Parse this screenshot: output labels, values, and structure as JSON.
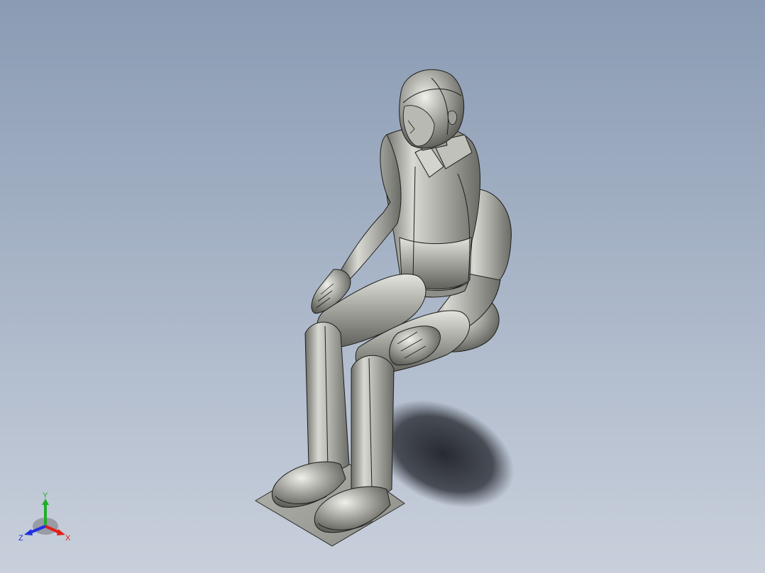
{
  "viewport": {
    "colors": {
      "background_top": "#8a9bb3",
      "background_bottom": "#c9d0dc",
      "model_metal": "#a9aaa4",
      "model_highlight": "#e6e6e0",
      "model_shadow": "#5d5e58",
      "floor_shadow": "#2b2e35",
      "base_plate": "#9c9d97"
    },
    "model": {
      "description_icon": "seated-human-model-icon"
    }
  },
  "triad": {
    "x_label": "X",
    "y_label": "Y",
    "z_label": "Z",
    "x_color": "#e0201c",
    "y_color": "#1fae2a",
    "z_color": "#1f2fe0"
  }
}
